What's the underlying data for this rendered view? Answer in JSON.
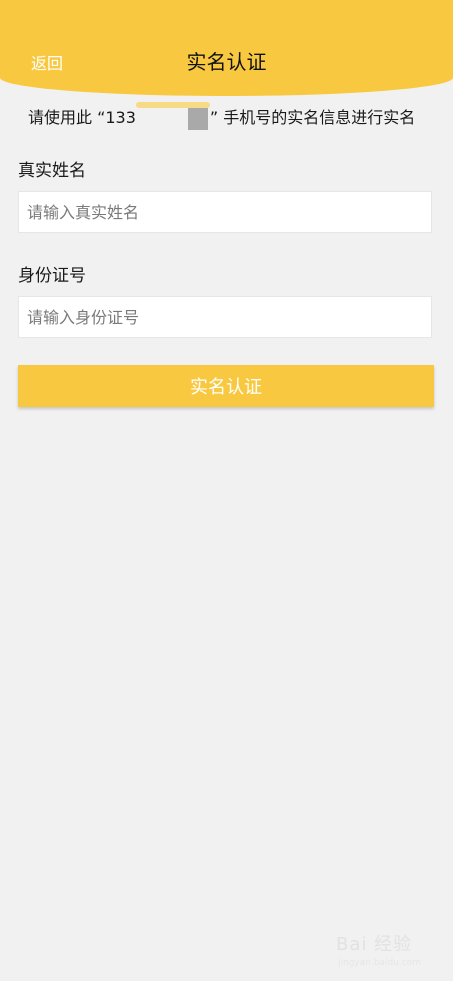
{
  "header": {
    "back_label": "返回",
    "title": "实名认证"
  },
  "notice": {
    "prefix": "请使用此 “133",
    "suffix": "” 手机号的实名信息进行实名"
  },
  "form": {
    "name_label": "真实姓名",
    "name_placeholder": "请输入真实姓名",
    "id_label": "身份证号",
    "id_placeholder": "请输入身份证号",
    "submit_label": "实名认证"
  },
  "watermark": {
    "brand": "Bai 经验",
    "url": "jingyan.baidu.com"
  },
  "colors": {
    "accent": "#f8c940",
    "background": "#f1f1f1"
  }
}
